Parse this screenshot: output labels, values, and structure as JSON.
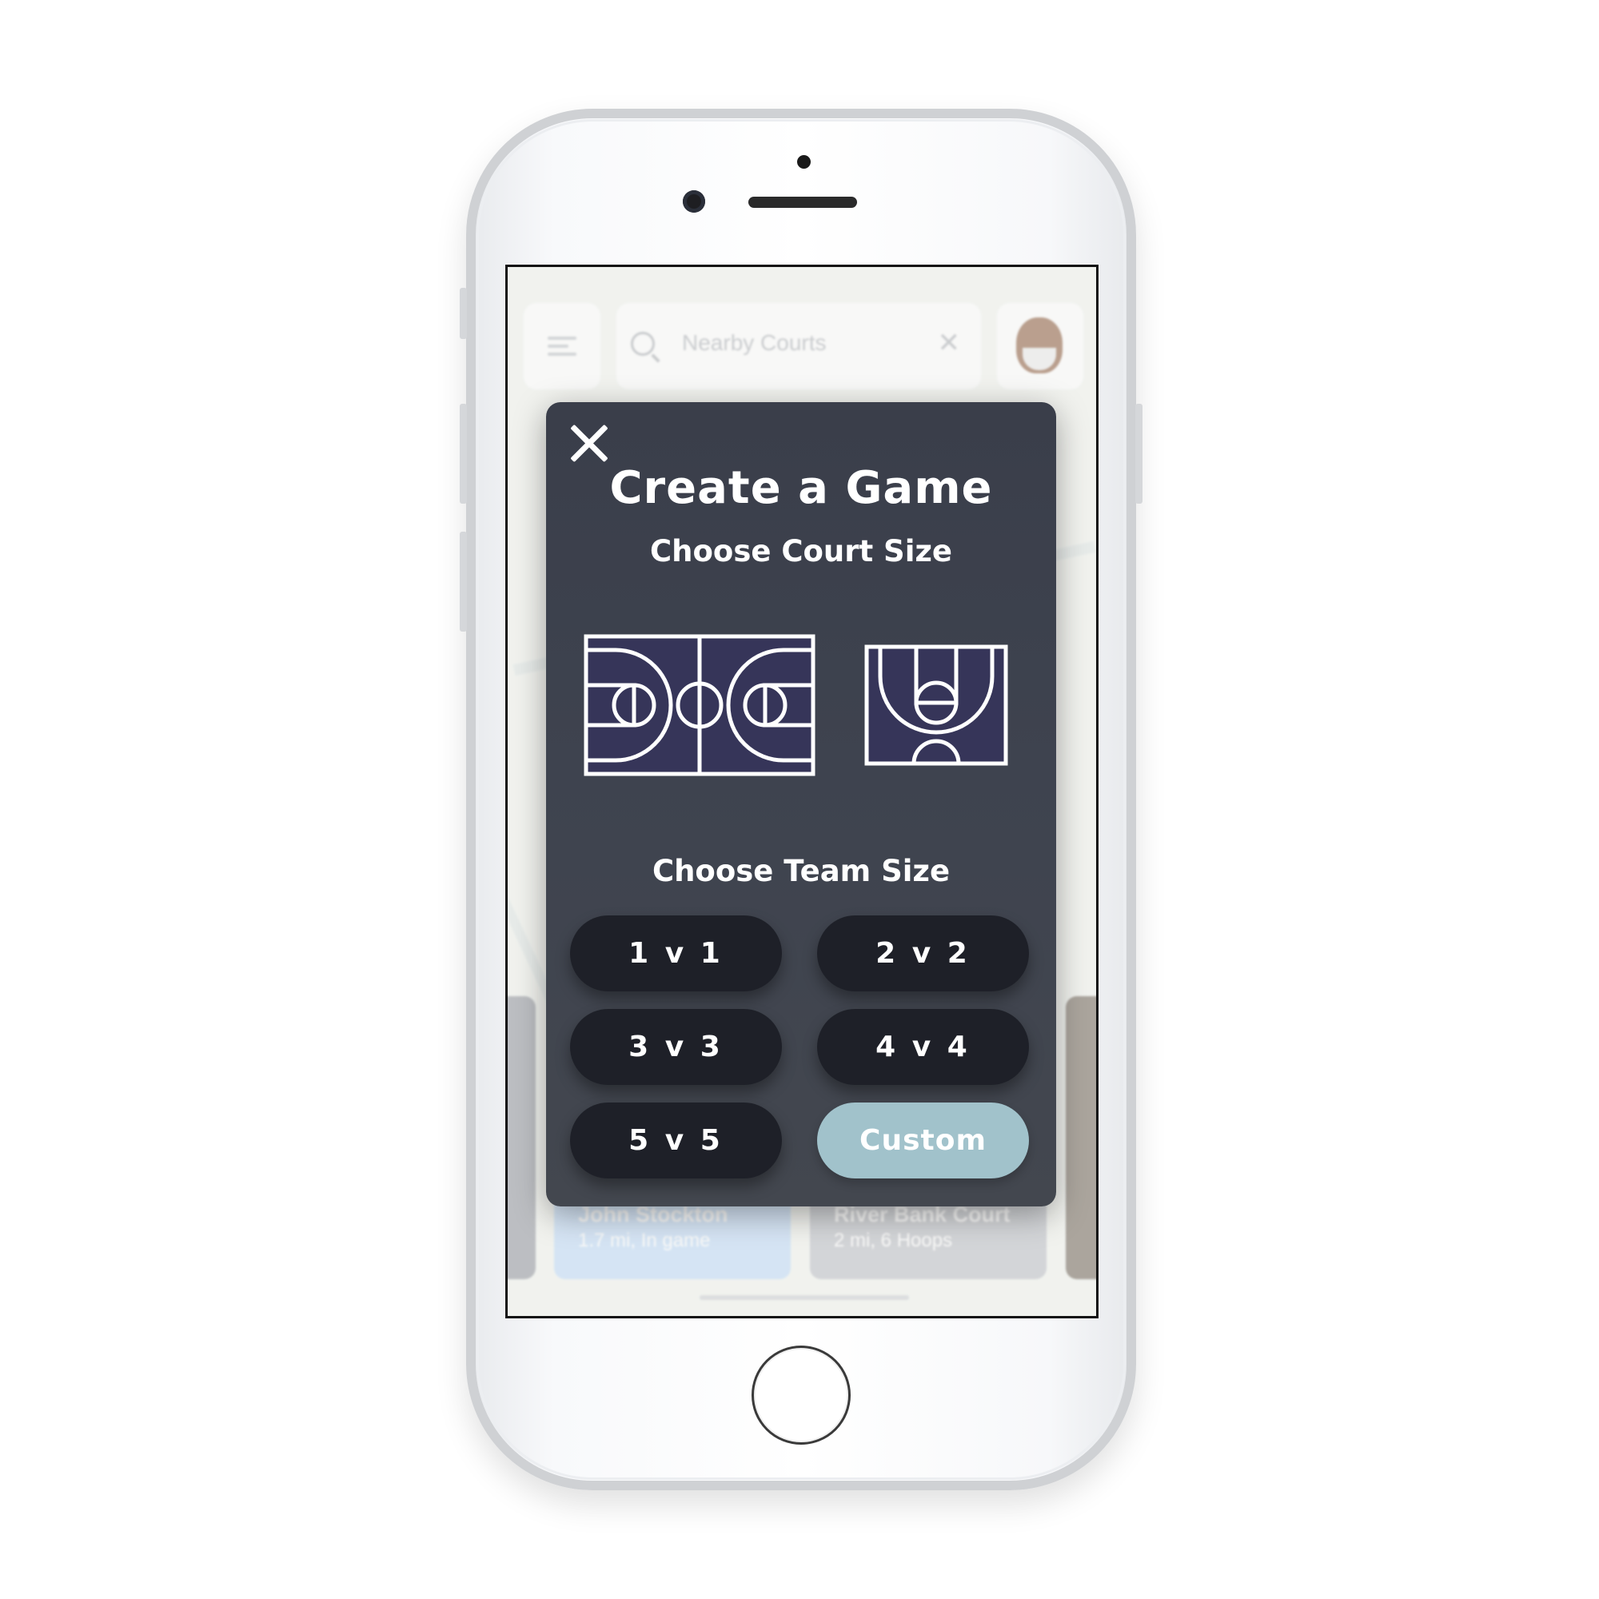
{
  "app": {
    "search": {
      "value": "Nearby Courts"
    },
    "cards": [
      {
        "title": "John Stockton",
        "subtitle": "1.7 mi, In game",
        "color": "#bcd8f6"
      },
      {
        "title": "River Bank Court",
        "subtitle": "2 mi, 6 Hoops",
        "color": "#b9bcc3"
      }
    ],
    "icons": [
      "menu-icon",
      "search-icon",
      "clear-icon",
      "avatar"
    ]
  },
  "modal": {
    "title": "Create a Game",
    "court_section": "Choose Court Size",
    "courts": [
      {
        "name": "full-court",
        "icon": "full-court-icon"
      },
      {
        "name": "half-court",
        "icon": "half-court-icon"
      }
    ],
    "team_section": "Choose Team Size",
    "team_options": [
      "1 v 1",
      "2 v 2",
      "3 v 3",
      "4 v 4",
      "5 v 5",
      "Custom"
    ],
    "colors": {
      "modal_bg": "#3e434f",
      "button_bg": "#1e2028",
      "accent": "#a1c2cb",
      "court_fill": "#363559"
    }
  }
}
